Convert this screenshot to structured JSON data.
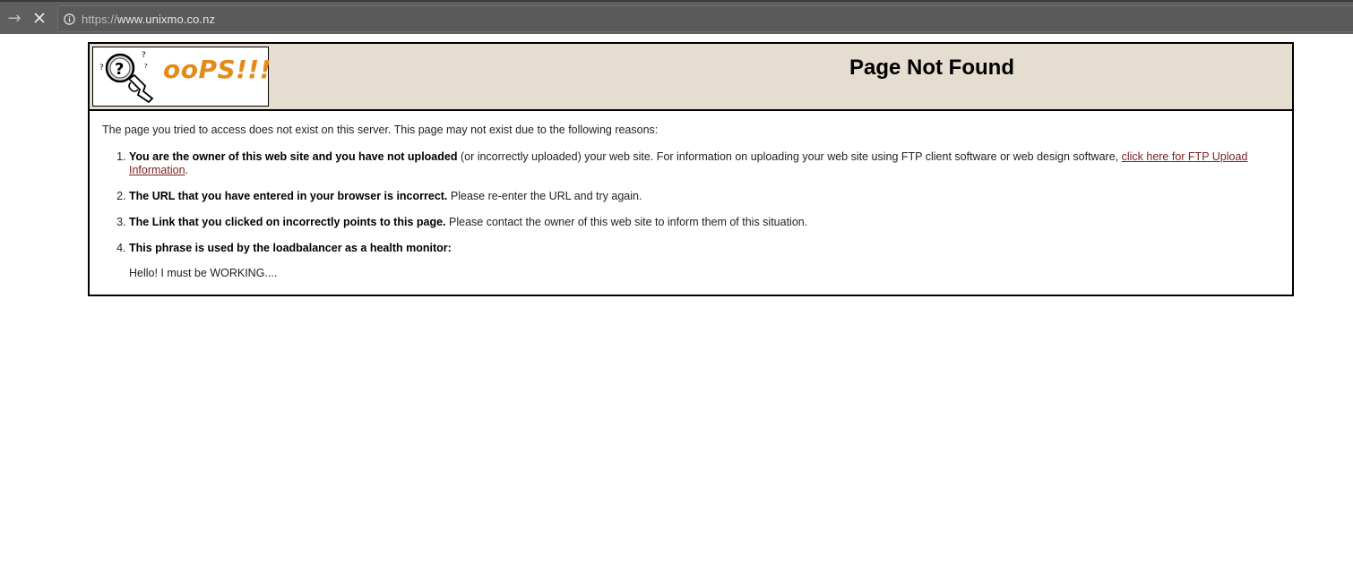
{
  "browser": {
    "url_scheme": "https://",
    "url_host": "www.unixmo.co.nz",
    "forward_icon": "arrow-right-icon",
    "stop_icon": "close-icon",
    "info_icon": "info-icon"
  },
  "header": {
    "logo_text": "ooPS!!!",
    "title": "Page Not Found"
  },
  "content": {
    "intro": "The page you tried to access does not exist on this server. This page may not exist due to the following reasons:",
    "reasons": [
      {
        "bold": "You are the owner of this web site and you have not uploaded",
        "text": " (or incorrectly uploaded) your web site. For information on uploading your web site using FTP client software or web design software, ",
        "link": "click here for FTP Upload Information",
        "tail": "."
      },
      {
        "bold": "The URL that you have entered in your browser is incorrect.",
        "text": " Please re-enter the URL and try again."
      },
      {
        "bold": "The Link that you clicked on incorrectly points to this page.",
        "text": " Please contact the owner of this web site to inform them of this situation."
      },
      {
        "bold": "This phrase is used by the loadbalancer as a health monitor:",
        "phrase": "Hello! I must be WORKING...."
      }
    ]
  },
  "colors": {
    "header_bg": "#e5ddd0",
    "logo_orange": "#e48a18",
    "link": "#7a1f1f",
    "browser_bar": "#5f5f5f"
  }
}
